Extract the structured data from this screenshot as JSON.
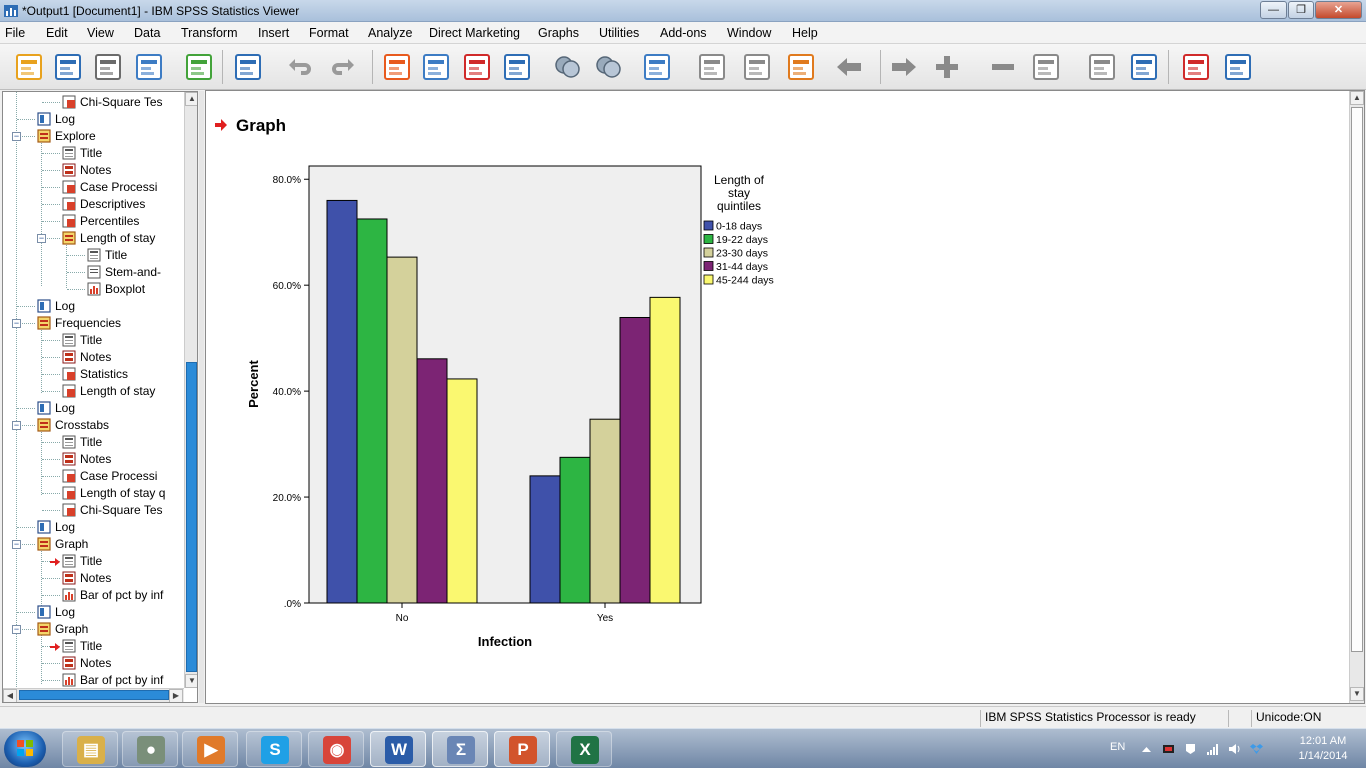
{
  "window": {
    "title": "*Output1 [Document1] - IBM SPSS Statistics Viewer",
    "buttons": {
      "minimize": "—",
      "maximize": "❐",
      "close": "✕"
    }
  },
  "menu": [
    "File",
    "Edit",
    "View",
    "Data",
    "Transform",
    "Insert",
    "Format",
    "Analyze",
    "Direct Marketing",
    "Graphs",
    "Utilities",
    "Add-ons",
    "Window",
    "Help"
  ],
  "toolbar": {
    "icons": [
      "open-icon",
      "save-icon",
      "print-icon",
      "print-preview-icon",
      "export-icon",
      "recall-dialog-icon",
      "undo-icon",
      "redo-icon",
      "goto-data-icon",
      "goto-case-icon",
      "goto-variable-icon",
      "variables-icon",
      "show-all-icon",
      "hide-icon",
      "insert-heading-icon",
      "insert-title-icon",
      "insert-text-icon",
      "insert-chart-icon",
      "promote-icon",
      "demote-icon",
      "expand-icon",
      "collapse-icon",
      "show-icon",
      "hide-items-icon",
      "designate-window-icon",
      "select-last-output-icon",
      "pivot-icon"
    ]
  },
  "outline": {
    "items": [
      {
        "label": "Chi-Square Tes",
        "icon": "table-icon",
        "level": 3
      },
      {
        "label": "Log",
        "icon": "log-icon",
        "level": 2
      },
      {
        "label": "Explore",
        "icon": "procedure-icon",
        "level": 2,
        "toggle": "−"
      },
      {
        "label": "Title",
        "icon": "title-icon",
        "level": 3
      },
      {
        "label": "Notes",
        "icon": "notes-icon",
        "level": 3
      },
      {
        "label": "Case Processi",
        "icon": "table-icon",
        "level": 3
      },
      {
        "label": "Descriptives",
        "icon": "table-icon",
        "level": 3
      },
      {
        "label": "Percentiles",
        "icon": "table-icon",
        "level": 3
      },
      {
        "label": "Length of stay",
        "icon": "procedure-icon",
        "level": 3,
        "toggle": "−"
      },
      {
        "label": "Title",
        "icon": "title-icon",
        "level": 4
      },
      {
        "label": "Stem-and-",
        "icon": "text-icon",
        "level": 4
      },
      {
        "label": "Boxplot",
        "icon": "chart-icon",
        "level": 4
      },
      {
        "label": "Log",
        "icon": "log-icon",
        "level": 2
      },
      {
        "label": "Frequencies",
        "icon": "procedure-icon",
        "level": 2,
        "toggle": "−"
      },
      {
        "label": "Title",
        "icon": "title-icon",
        "level": 3
      },
      {
        "label": "Notes",
        "icon": "notes-icon",
        "level": 3
      },
      {
        "label": "Statistics",
        "icon": "table-icon",
        "level": 3
      },
      {
        "label": "Length of stay",
        "icon": "table-icon",
        "level": 3
      },
      {
        "label": "Log",
        "icon": "log-icon",
        "level": 2
      },
      {
        "label": "Crosstabs",
        "icon": "procedure-icon",
        "level": 2,
        "toggle": "−"
      },
      {
        "label": "Title",
        "icon": "title-icon",
        "level": 3
      },
      {
        "label": "Notes",
        "icon": "notes-icon",
        "level": 3
      },
      {
        "label": "Case Processi",
        "icon": "table-icon",
        "level": 3
      },
      {
        "label": "Length of stay q",
        "icon": "table-icon",
        "level": 3
      },
      {
        "label": "Chi-Square Tes",
        "icon": "table-icon",
        "level": 3
      },
      {
        "label": "Log",
        "icon": "log-icon",
        "level": 2
      },
      {
        "label": "Graph",
        "icon": "procedure-icon",
        "level": 2,
        "toggle": "−"
      },
      {
        "label": "Title",
        "icon": "title-icon",
        "level": 3,
        "arrow": true
      },
      {
        "label": "Notes",
        "icon": "notes-icon",
        "level": 3
      },
      {
        "label": "Bar of pct by inf",
        "icon": "chart-icon",
        "level": 3
      },
      {
        "label": "Log",
        "icon": "log-icon",
        "level": 2
      },
      {
        "label": "Graph",
        "icon": "procedure-icon",
        "level": 2,
        "toggle": "−"
      },
      {
        "label": "Title",
        "icon": "title-icon",
        "level": 3,
        "arrow": true
      },
      {
        "label": "Notes",
        "icon": "notes-icon",
        "level": 3
      },
      {
        "label": "Bar of pct by inf",
        "icon": "chart-icon",
        "level": 3
      }
    ],
    "scroll": {
      "up": "▲",
      "down": "▼",
      "left": "◀",
      "right": "▶"
    }
  },
  "content": {
    "heading": "Graph"
  },
  "chart_data": {
    "type": "bar",
    "xlabel": "Infection",
    "ylabel": "Percent",
    "categories": [
      "No",
      "Yes"
    ],
    "ylim": [
      0,
      80
    ],
    "yticks": [
      ".0%",
      "20.0%",
      "40.0%",
      "60.0%",
      "80.0%"
    ],
    "ytick_values": [
      0,
      20,
      40,
      60,
      80
    ],
    "legend_title": [
      "Length of",
      "stay",
      "quintiles"
    ],
    "legend_position": "right",
    "grid": false,
    "series": [
      {
        "name": "0-18 days",
        "color": "#3f51aa",
        "values": [
          76.0,
          24.0
        ]
      },
      {
        "name": "19-22 days",
        "color": "#2db543",
        "values": [
          72.5,
          27.5
        ]
      },
      {
        "name": "23-30 days",
        "color": "#d4d19b",
        "values": [
          65.3,
          34.7
        ]
      },
      {
        "name": "31-44 days",
        "color": "#7c2474",
        "values": [
          46.1,
          53.9
        ]
      },
      {
        "name": "45-244 days",
        "color": "#faf870",
        "values": [
          42.3,
          57.7
        ]
      }
    ],
    "plot_background": "#efefef"
  },
  "status": {
    "processor": "IBM SPSS Statistics Processor is ready",
    "unicode": "Unicode:ON"
  },
  "taskbar": {
    "apps": [
      {
        "name": "explorer-icon",
        "glyph": "▤",
        "color": "#d9b04a"
      },
      {
        "name": "app-circle-icon",
        "glyph": "●",
        "color": "#7a8f7a"
      },
      {
        "name": "media-player-icon",
        "glyph": "▶",
        "color": "#e07a2a"
      },
      {
        "name": "skype-icon",
        "glyph": "S",
        "color": "#1fa0e6"
      },
      {
        "name": "chrome-icon",
        "glyph": "◉",
        "color": "#d8453a"
      },
      {
        "name": "word-icon",
        "glyph": "W",
        "color": "#2b5ca8"
      },
      {
        "name": "spss-icon",
        "glyph": "Σ",
        "color": "#6a86b5"
      },
      {
        "name": "powerpoint-icon",
        "glyph": "P",
        "color": "#d2542c"
      },
      {
        "name": "excel-icon",
        "glyph": "X",
        "color": "#207345"
      }
    ],
    "language": "EN",
    "time": "12:01 AM",
    "date": "1/14/2014"
  }
}
